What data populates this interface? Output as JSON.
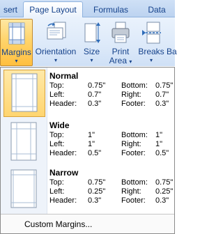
{
  "tabs": [
    {
      "label": "sert",
      "active": false
    },
    {
      "label": "Page Layout",
      "active": true
    },
    {
      "label": "Formulas",
      "active": false
    },
    {
      "label": "Data",
      "active": false
    }
  ],
  "ribbon": {
    "margins": {
      "label": "Margins",
      "icon": "margins-icon"
    },
    "orientation": {
      "label": "Orientation",
      "icon": "orientation-icon"
    },
    "size": {
      "label": "Size",
      "icon": "size-icon"
    },
    "print_area": {
      "label": "Print",
      "label2": "Area",
      "icon": "print-area-icon"
    },
    "breaks": {
      "label": "Breaks",
      "icon": "breaks-icon"
    },
    "background": {
      "label": "Ba"
    }
  },
  "menu": {
    "presets": [
      {
        "name": "Normal",
        "selected": true,
        "top_label": "Top:",
        "top": "0.75\"",
        "bottom_label": "Bottom:",
        "bottom": "0.75\"",
        "left_label": "Left:",
        "left": "0.7\"",
        "right_label": "Right:",
        "right": "0.7\"",
        "header_label": "Header:",
        "header": "0.3\"",
        "footer_label": "Footer:",
        "footer": "0.3\""
      },
      {
        "name": "Wide",
        "selected": false,
        "top_label": "Top:",
        "top": "1\"",
        "bottom_label": "Bottom:",
        "bottom": "1\"",
        "left_label": "Left:",
        "left": "1\"",
        "right_label": "Right:",
        "right": "1\"",
        "header_label": "Header:",
        "header": "0.5\"",
        "footer_label": "Footer:",
        "footer": "0.5\""
      },
      {
        "name": "Narrow",
        "selected": false,
        "top_label": "Top:",
        "top": "0.75\"",
        "bottom_label": "Bottom:",
        "bottom": "0.75\"",
        "left_label": "Left:",
        "left": "0.25\"",
        "right_label": "Right:",
        "right": "0.25\"",
        "header_label": "Header:",
        "header": "0.3\"",
        "footer_label": "Footer:",
        "footer": "0.3\""
      }
    ],
    "custom_label": "Custom Margins..."
  },
  "colors": {
    "tab_text": "#15428b",
    "ribbon_bg": "#dce9f9",
    "active_button": "#ffd46b",
    "menu_border": "#8a8a8a"
  }
}
